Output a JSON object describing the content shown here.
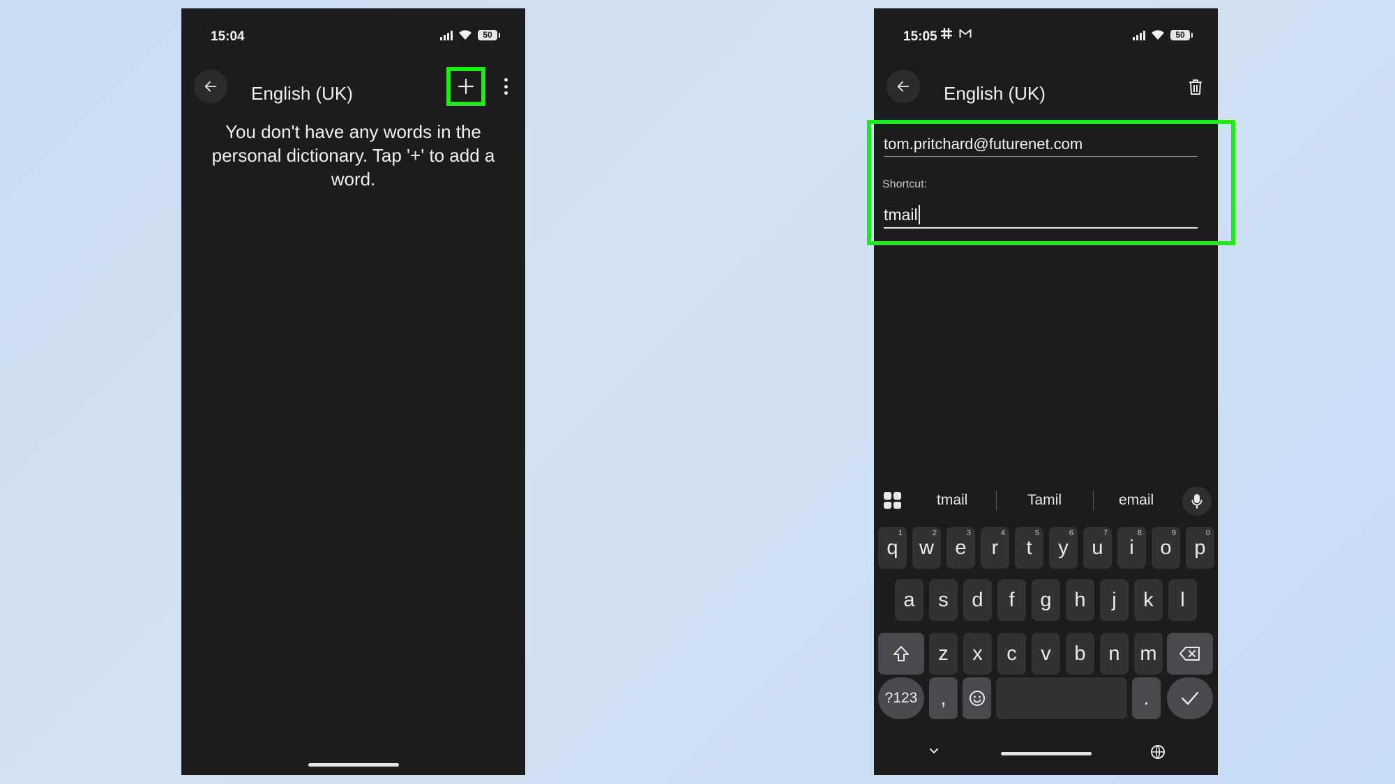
{
  "left": {
    "status": {
      "time": "15:04",
      "battery": "50"
    },
    "header": {
      "title": "English (UK)"
    },
    "empty_message": "You don't have any words in the personal dictionary. Tap '+' to add a word."
  },
  "right": {
    "status": {
      "time": "15:05",
      "battery": "50"
    },
    "header": {
      "title": "English (UK)"
    },
    "word_value": "tom.pritchard@futurenet.com",
    "shortcut_label": "Shortcut:",
    "shortcut_value": "tmail",
    "suggestions": [
      "tmail",
      "Tamil",
      "email"
    ],
    "keyboard": {
      "row1": [
        {
          "k": "q",
          "n": "1"
        },
        {
          "k": "w",
          "n": "2"
        },
        {
          "k": "e",
          "n": "3"
        },
        {
          "k": "r",
          "n": "4"
        },
        {
          "k": "t",
          "n": "5"
        },
        {
          "k": "y",
          "n": "6"
        },
        {
          "k": "u",
          "n": "7"
        },
        {
          "k": "i",
          "n": "8"
        },
        {
          "k": "o",
          "n": "9"
        },
        {
          "k": "p",
          "n": "0"
        }
      ],
      "row2": [
        "a",
        "s",
        "d",
        "f",
        "g",
        "h",
        "j",
        "k",
        "l"
      ],
      "row3": [
        "z",
        "x",
        "c",
        "v",
        "b",
        "n",
        "m"
      ],
      "symbols_label": "?123",
      "comma": ",",
      "period": "."
    }
  },
  "highlight_color": "#22e81c"
}
